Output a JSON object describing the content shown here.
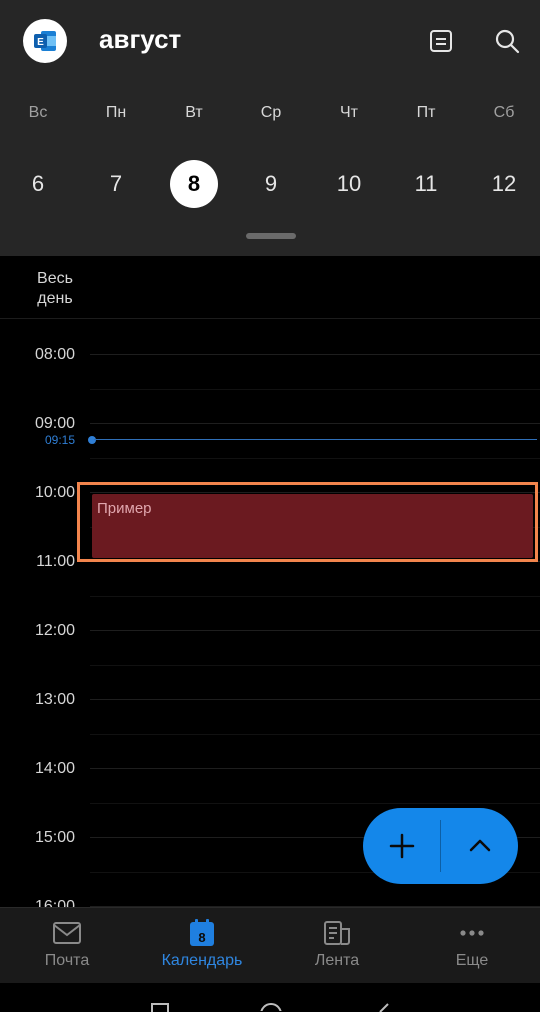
{
  "header": {
    "title": "август",
    "app_icon": "outlook-icon",
    "agenda_icon": "agenda-view-icon",
    "search_icon": "search-icon"
  },
  "weekdays": [
    {
      "label": "Вс",
      "weekend": true
    },
    {
      "label": "Пн",
      "weekend": false
    },
    {
      "label": "Вт",
      "weekend": false
    },
    {
      "label": "Ср",
      "weekend": false
    },
    {
      "label": "Чт",
      "weekend": false
    },
    {
      "label": "Пт",
      "weekend": false
    },
    {
      "label": "Сб",
      "weekend": true
    }
  ],
  "days": [
    {
      "label": "6",
      "selected": false
    },
    {
      "label": "7",
      "selected": false
    },
    {
      "label": "8",
      "selected": true
    },
    {
      "label": "9",
      "selected": false
    },
    {
      "label": "10",
      "selected": false
    },
    {
      "label": "11",
      "selected": false
    },
    {
      "label": "12",
      "selected": false
    }
  ],
  "all_day": {
    "label": "Весь\nдень"
  },
  "hours": [
    "08:00",
    "09:00",
    "10:00",
    "11:00",
    "12:00",
    "13:00",
    "14:00",
    "15:00",
    "16:00"
  ],
  "current_time": "09:15",
  "event": {
    "title": "Пример",
    "color": "#6b1a20"
  },
  "highlight_color": "#f2854d",
  "fab": {
    "add_icon": "plus-icon",
    "expand_icon": "chevron-up-icon",
    "color": "#1487ea"
  },
  "bottom_nav": [
    {
      "label": "Почта",
      "icon": "mail-icon",
      "active": false
    },
    {
      "label": "Календарь",
      "icon": "calendar-icon",
      "badge": "8",
      "active": true
    },
    {
      "label": "Лента",
      "icon": "feed-icon",
      "active": false
    },
    {
      "label": "Еще",
      "icon": "more-icon",
      "active": false
    }
  ],
  "accent_color": "#2f86e0"
}
